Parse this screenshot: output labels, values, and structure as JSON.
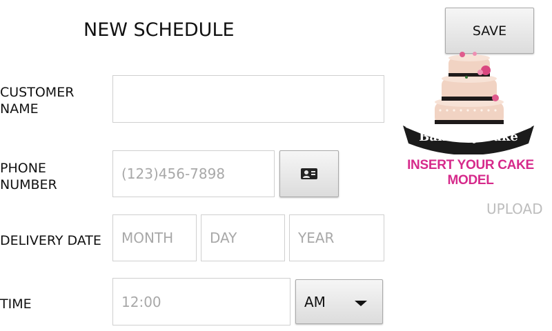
{
  "header": {
    "title": "NEW SCHEDULE",
    "save_label": "SAVE"
  },
  "form": {
    "customer_name": {
      "label_line1": "CUSTOMER",
      "label_line2": "NAME",
      "value": ""
    },
    "phone": {
      "label_line1": "PHONE",
      "label_line2": "NUMBER",
      "placeholder": "(123)456-7898",
      "contact_icon": "contact-card-icon"
    },
    "delivery_date": {
      "label": "DELIVERY DATE",
      "month_placeholder": "MONTH",
      "day_placeholder": "DAY",
      "year_placeholder": "YEAR"
    },
    "time": {
      "label": "TIME",
      "placeholder": "12:00",
      "ampm_selected": "AM"
    }
  },
  "cake": {
    "logo_text": "Bake My Cake",
    "prompt": "INSERT YOUR CAKE MODEL",
    "upload_label": "UPLOAD",
    "colors": {
      "cream": "#f3d9c9",
      "band": "#1e1a1a",
      "pink": "#d62a8b"
    }
  }
}
